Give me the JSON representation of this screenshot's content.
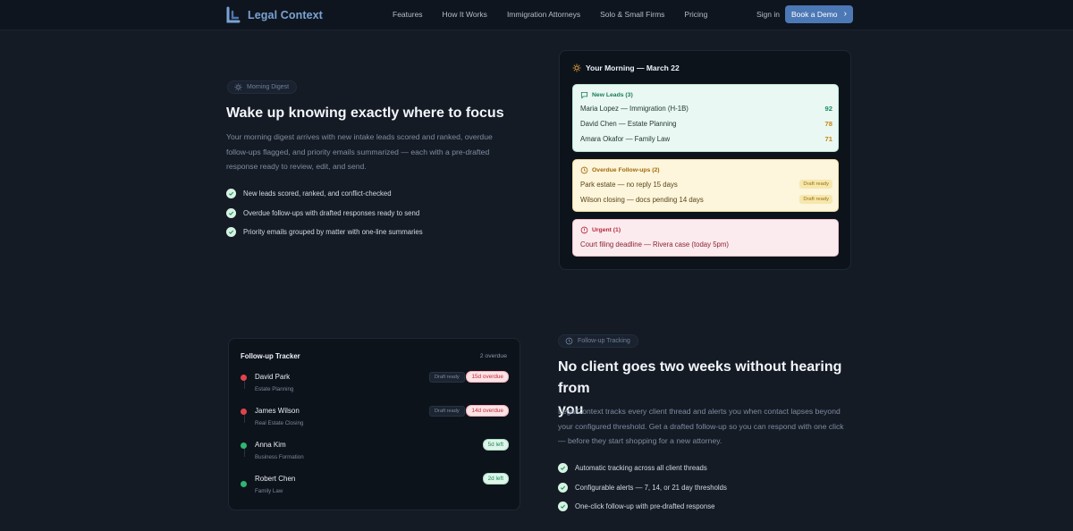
{
  "nav": {
    "brand": "Legal Context",
    "links": [
      "Features",
      "How It Works",
      "Immigration Attorneys",
      "Solo & Small Firms",
      "Pricing"
    ],
    "signin": "Sign in",
    "cta": "Book a Demo",
    "brand_color": "#7aa3d6",
    "cta_color": "#4c78b5"
  },
  "digest": {
    "pill": "Morning Digest",
    "heading": "Wake up knowing exactly where to focus",
    "paragraph_lines": [
      "Your morning digest arrives with new intake leads scored and ranked, overdue",
      "follow-ups flagged, and priority emails summarized — each with a pre-drafted",
      "response ready to review, edit, and send."
    ],
    "checks": [
      "New leads scored, ranked, and conflict-checked",
      "Overdue follow-ups with drafted responses ready to send",
      "Priority emails grouped by matter with one-line summaries"
    ]
  },
  "morning_card": {
    "title": "Your Morning — March 22",
    "new_leads": {
      "title": "New Leads (3)",
      "rows": [
        {
          "label": "Maria Lopez — Immigration (H-1B)",
          "score": "92",
          "color": "#1b8a5f"
        },
        {
          "label": "David Chen — Estate Planning",
          "score": "78",
          "color": "#c4860f"
        },
        {
          "label": "Amara Okafor — Family Law",
          "score": "71",
          "color": "#c4860f"
        }
      ]
    },
    "followups": {
      "title": "Overdue Follow-ups (2)",
      "rows": [
        {
          "label": "Park estate — no reply 15 days",
          "tag": "Draft ready"
        },
        {
          "label": "Wilson closing — docs pending 14 days",
          "tag": "Draft ready"
        }
      ]
    },
    "urgent": {
      "title": "Urgent (1)",
      "rows": [
        {
          "label": "Court filing deadline — Rivera case (today 5pm)"
        }
      ]
    }
  },
  "tracking": {
    "pill": "Follow-up Tracking",
    "heading_lines": [
      "No client goes two weeks without hearing from",
      "you"
    ],
    "paragraph_lines": [
      "LegalContext tracks every client thread and alerts you when contact lapses beyond",
      "your configured threshold. Get a drafted follow-up so you can respond with one click",
      "— before they start shopping for a new attorney."
    ],
    "checks": [
      "Automatic tracking across all client threads",
      "Configurable alerts — 7, 14, or 21 day thresholds",
      "One-click follow-up with pre-drafted response"
    ]
  },
  "tracker_card": {
    "title": "Follow-up Tracker",
    "count": "2 overdue",
    "rows": [
      {
        "name": "David Park",
        "sub": "Estate Planning",
        "draft": "Draft ready",
        "badge": "15d overdue",
        "status": "red"
      },
      {
        "name": "James Wilson",
        "sub": "Real Estate Closing",
        "draft": "Draft ready",
        "badge": "14d overdue",
        "status": "red"
      },
      {
        "name": "Anna Kim",
        "sub": "Business Formation",
        "draft": "",
        "badge": "5d left",
        "status": "green"
      },
      {
        "name": "Robert Chen",
        "sub": "Family Law",
        "draft": "",
        "badge": "2d left",
        "status": "green"
      }
    ],
    "status_colors": {
      "red": "#e0434d",
      "green": "#2fb673"
    }
  }
}
